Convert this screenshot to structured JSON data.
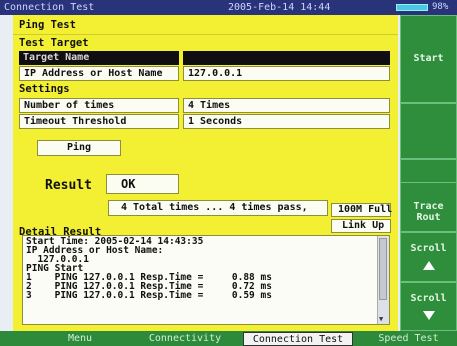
{
  "titlebar": {
    "window_title": "Connection Test",
    "datetime": "2005-Feb-14 14:44",
    "battery_pct": "98%",
    "battery_level": 0.98
  },
  "panel": {
    "title": "Ping Test"
  },
  "target": {
    "section": "Test Target",
    "name_label": "Target Name",
    "name_value": "",
    "ip_label": "IP Address or Host Name",
    "ip_value": "127.0.0.1"
  },
  "settings": {
    "section": "Settings",
    "times_label": "Number of times",
    "times_value": "4 Times",
    "timeout_label": "Timeout Threshold",
    "timeout_value": "1 Seconds"
  },
  "ping_label": "Ping",
  "result": {
    "label": "Result",
    "value": "OK",
    "summary": "4 Total times ... 4 times pass,",
    "speed": "100M Full",
    "link": "Link Up"
  },
  "detail": {
    "label": "Detail Result",
    "lines": [
      "Start Time: 2005-02-14 14:43:35",
      "IP Address or Host Name:",
      "  127.0.0.1",
      "PING Start",
      "1    PING 127.0.0.1 Resp.Time =     0.88 ms",
      "2    PING 127.0.0.1 Resp.Time =     0.72 ms",
      "3    PING 127.0.0.1 Resp.Time =     0.59 ms"
    ]
  },
  "side_buttons": {
    "start": "Start",
    "trace": "Trace Rout",
    "scroll_up": "Scroll",
    "scroll_down": "Scroll"
  },
  "tabs": [
    "Menu",
    "Connectivity",
    "Connection Test",
    "Speed Test"
  ],
  "active_tab": "Connection Test",
  "colors": {
    "panel": "#f3f034",
    "side": "#2e8e3c",
    "titlebar": "#28337a"
  },
  "icons": {
    "scroll_up": "up-triangle-icon",
    "scroll_down": "down-triangle-icon"
  }
}
